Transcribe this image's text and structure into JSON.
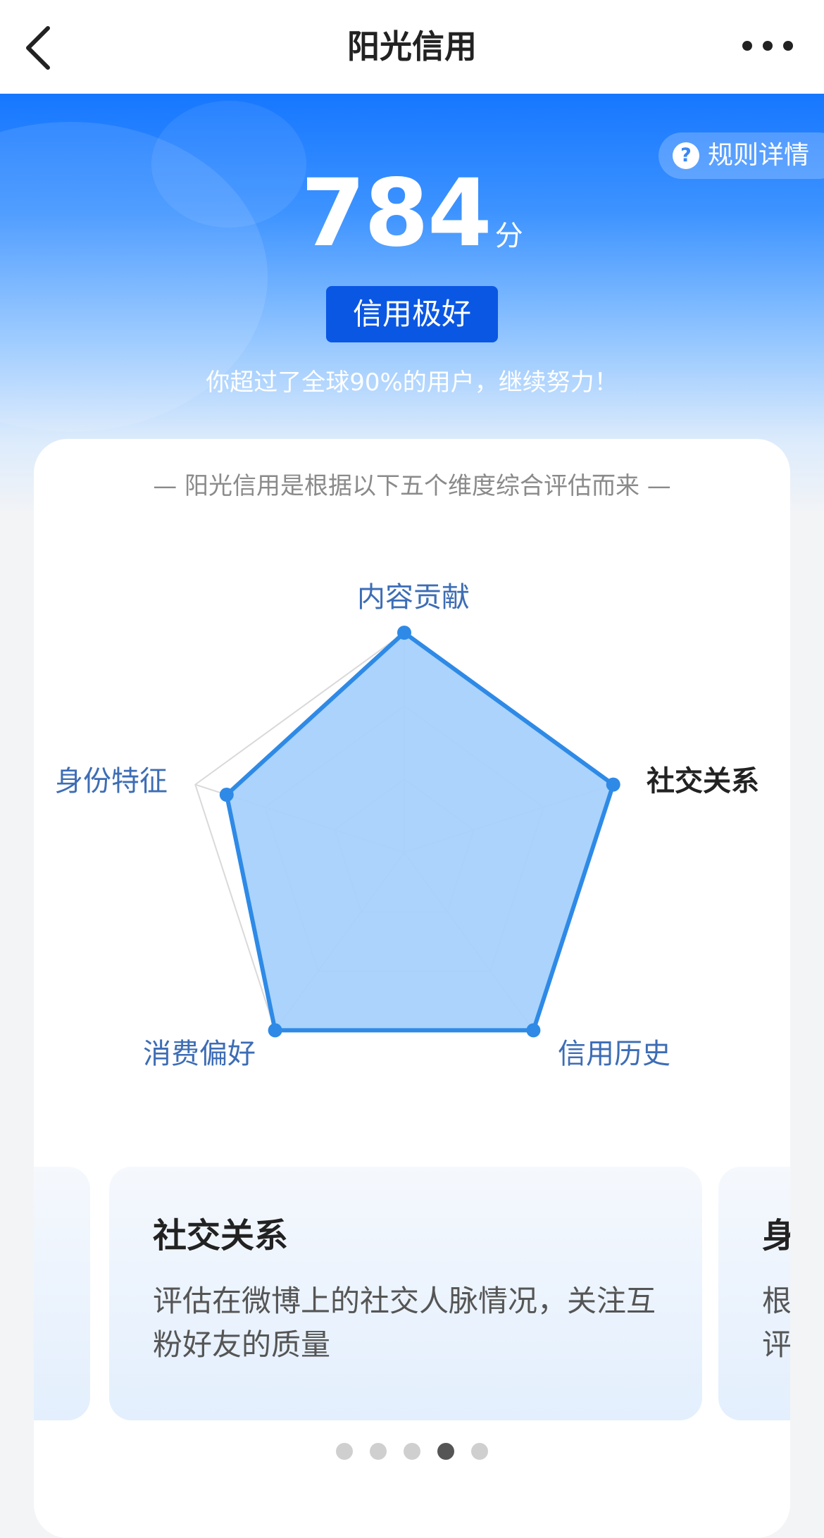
{
  "nav": {
    "title": "阳光信用",
    "back_icon": "chevron-left-icon",
    "more_icon": "more-horizontal-icon"
  },
  "hero": {
    "rules_label": "规则详情",
    "rules_icon": "question-circle-icon",
    "score": "784",
    "score_unit": "分",
    "level": "信用极好",
    "subtitle": "你超过了全球90%的用户，继续努力！"
  },
  "radar": {
    "intro": "— 阳光信用是根据以下五个维度综合评估而来 —",
    "axes": [
      {
        "label": "内容贡献",
        "value": 1.0,
        "active": false
      },
      {
        "label": "社交关系",
        "value": 1.0,
        "active": true
      },
      {
        "label": "信用历史",
        "value": 1.0,
        "active": false
      },
      {
        "label": "消费偏好",
        "value": 1.0,
        "active": false
      },
      {
        "label": "身份特征",
        "value": 0.85,
        "active": false
      }
    ],
    "levels": 3,
    "fill_color": "#a6d1fb",
    "line_color": "#2e8ae6",
    "grid_color": "#d9d9d9"
  },
  "dimension_cards": {
    "prev": {
      "title": "",
      "desc": ""
    },
    "current": {
      "title": "社交关系",
      "desc": "评估在微博上的社交人脉情况，关注互粉好友的质量"
    },
    "next": {
      "title": "身",
      "desc_line1": "根",
      "desc_line2": "评"
    }
  },
  "pagination": {
    "count": 5,
    "active_index": 3
  }
}
